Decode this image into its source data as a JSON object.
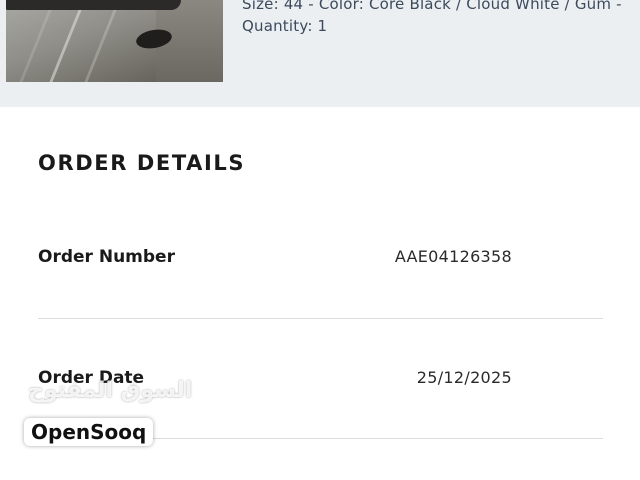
{
  "product": {
    "variant_line": "Size: 44 - Color: Core Black / Cloud White / Gum -",
    "quantity_line": "Quantity: 1"
  },
  "order_details": {
    "title": "ORDER DETAILS",
    "rows": [
      {
        "label": "Order Number",
        "value": "AAE04126358"
      },
      {
        "label": "Order Date",
        "value": "25/12/2025"
      }
    ]
  },
  "watermark": {
    "arabic": "السوق المفتوح",
    "brand": "OpenSooq"
  },
  "colors": {
    "band_background": "#eceff2",
    "variant_text": "#3c4a5c",
    "divider": "#dcdcdc"
  }
}
